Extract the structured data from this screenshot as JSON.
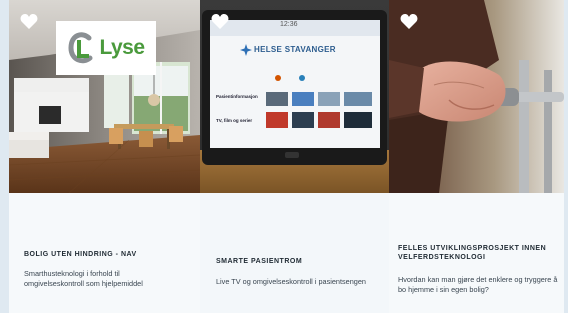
{
  "cards": [
    {
      "title": "BOLIG UTEN HINDRING - NAV",
      "description": "Smarthusteknologi i forhold til omgivelseskontroll som hjelpemiddel",
      "logo_text": "Lyse",
      "favorite_icon": "heart-icon"
    },
    {
      "title": "SMARTE PASIENTROM",
      "description": "Live TV og omgivelseskontroll i pasientsengen",
      "favorite_icon": "heart-icon",
      "tablet": {
        "clock": "12:36",
        "brand": "HELSE STAVANGER",
        "menu_items": [
          "Pasientinformasjon",
          "TV, film og serier"
        ]
      }
    },
    {
      "title": "FELLES UTVIKLINGSPROSJEKT INNEN VELFERDSTEKNOLOGI",
      "description": "Hvordan kan man gjøre det enklere og tryggere å bo hjemme i sin egen bolig?",
      "favorite_icon": "heart-icon"
    }
  ],
  "colors": {
    "logo_green": "#4a9a3c",
    "logo_grey": "#8a8f93",
    "title_text": "#1f2a33",
    "body_text": "#3a4651",
    "background": "#eaf2f8"
  }
}
